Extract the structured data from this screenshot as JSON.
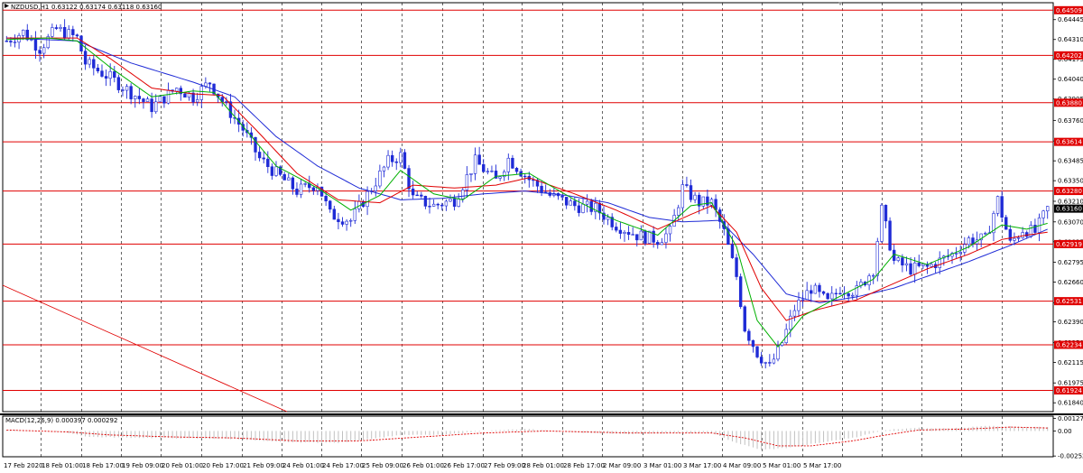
{
  "header": {
    "symbol_timeframe": "NZDUSD,H1",
    "ohlc": "0.63122 0.63174 0.63118 0.63160"
  },
  "macd_header": "MACD(12,26,9) 0.000397 0.000292",
  "colors": {
    "candles": "#1f2bd6",
    "ma_fast": "#00b000",
    "ma_mid": "#e00000",
    "ma_slow": "#1f2bd6",
    "levels": "#e00000",
    "grid": "#000000",
    "macd_hist": "#c0c0c0",
    "macd_signal": "#e00000"
  },
  "chart_data": {
    "type": "candlestick",
    "symbol": "NZDUSD",
    "timeframe": "H1",
    "ylim": [
      0.6178,
      0.6456
    ],
    "price_ticks": [
      "0.64445",
      "0.64310",
      "0.64175",
      "0.64040",
      "0.63905",
      "0.63760",
      "0.63620",
      "0.63485",
      "0.63350",
      "0.63210",
      "0.63070",
      "0.62935",
      "0.62795",
      "0.62660",
      "0.62520",
      "0.62390",
      "0.62250",
      "0.62115",
      "0.61975",
      "0.61840"
    ],
    "time_labels": [
      "17 Feb 2020",
      "18 Feb 01:00",
      "18 Feb 17:00",
      "19 Feb 09:00",
      "20 Feb 01:00",
      "20 Feb 17:00",
      "21 Feb 09:00",
      "24 Feb 01:00",
      "24 Feb 17:00",
      "25 Feb 09:00",
      "26 Feb 01:00",
      "26 Feb 17:00",
      "27 Feb 09:00",
      "28 Feb 01:00",
      "28 Feb 17:00",
      "2 Mar 09:00",
      "3 Mar 01:00",
      "3 Mar 17:00",
      "4 Mar 09:00",
      "5 Mar 01:00",
      "5 Mar 17:00"
    ],
    "current_price": "0.63160",
    "horizontal_levels": [
      "0.64509",
      "0.64202",
      "0.63880",
      "0.63614",
      "0.63280",
      "0.62919",
      "0.62531",
      "0.62234",
      "0.61924"
    ],
    "close_path": [
      [
        0,
        0.643
      ],
      [
        4,
        0.6436
      ],
      [
        8,
        0.6425
      ],
      [
        12,
        0.6438
      ],
      [
        17,
        0.6432
      ],
      [
        19,
        0.6415
      ],
      [
        25,
        0.6405
      ],
      [
        30,
        0.6395
      ],
      [
        35,
        0.6385
      ],
      [
        41,
        0.6398
      ],
      [
        45,
        0.6392
      ],
      [
        49,
        0.6402
      ],
      [
        53,
        0.6385
      ],
      [
        57,
        0.637
      ],
      [
        61,
        0.635
      ],
      [
        65,
        0.634
      ],
      [
        70,
        0.6328
      ],
      [
        75,
        0.6333
      ],
      [
        78,
        0.6312
      ],
      [
        83,
        0.6308
      ],
      [
        88,
        0.633
      ],
      [
        92,
        0.6348
      ],
      [
        95,
        0.6352
      ],
      [
        98,
        0.6323
      ],
      [
        103,
        0.6318
      ],
      [
        108,
        0.6322
      ],
      [
        113,
        0.6348
      ],
      [
        118,
        0.6335
      ],
      [
        121,
        0.635
      ],
      [
        126,
        0.6336
      ],
      [
        131,
        0.6325
      ],
      [
        137,
        0.6318
      ],
      [
        142,
        0.6316
      ],
      [
        147,
        0.6305
      ],
      [
        152,
        0.6298
      ],
      [
        157,
        0.6295
      ],
      [
        160,
        0.63
      ],
      [
        163,
        0.633
      ],
      [
        167,
        0.632
      ],
      [
        170,
        0.632
      ],
      [
        173,
        0.63
      ],
      [
        176,
        0.627
      ],
      [
        178,
        0.6235
      ],
      [
        181,
        0.6218
      ],
      [
        184,
        0.6208
      ],
      [
        187,
        0.6225
      ],
      [
        190,
        0.6248
      ],
      [
        194,
        0.6262
      ],
      [
        198,
        0.6252
      ],
      [
        201,
        0.6262
      ],
      [
        205,
        0.626
      ],
      [
        209,
        0.6275
      ],
      [
        211,
        0.6315
      ],
      [
        214,
        0.628
      ],
      [
        218,
        0.6275
      ],
      [
        222,
        0.6276
      ],
      [
        228,
        0.6285
      ],
      [
        232,
        0.6295
      ],
      [
        236,
        0.6295
      ],
      [
        239,
        0.6322
      ],
      [
        242,
        0.6292
      ],
      [
        245,
        0.6302
      ],
      [
        248,
        0.63
      ],
      [
        251,
        0.6316
      ]
    ],
    "ma_fast_path": [
      [
        0,
        0.6431
      ],
      [
        10,
        0.6432
      ],
      [
        17,
        0.643
      ],
      [
        25,
        0.6412
      ],
      [
        35,
        0.6392
      ],
      [
        45,
        0.6396
      ],
      [
        50,
        0.6395
      ],
      [
        57,
        0.6372
      ],
      [
        65,
        0.6345
      ],
      [
        75,
        0.633
      ],
      [
        83,
        0.6315
      ],
      [
        90,
        0.6325
      ],
      [
        95,
        0.6342
      ],
      [
        103,
        0.6326
      ],
      [
        110,
        0.6322
      ],
      [
        118,
        0.6338
      ],
      [
        126,
        0.634
      ],
      [
        137,
        0.6322
      ],
      [
        147,
        0.6308
      ],
      [
        157,
        0.6298
      ],
      [
        165,
        0.6318
      ],
      [
        170,
        0.632
      ],
      [
        176,
        0.629
      ],
      [
        181,
        0.624
      ],
      [
        186,
        0.6222
      ],
      [
        192,
        0.6243
      ],
      [
        200,
        0.6255
      ],
      [
        209,
        0.6268
      ],
      [
        214,
        0.6285
      ],
      [
        222,
        0.6278
      ],
      [
        232,
        0.629
      ],
      [
        240,
        0.6305
      ],
      [
        246,
        0.6302
      ],
      [
        251,
        0.6306
      ]
    ],
    "ma_mid_path": [
      [
        0,
        0.6432
      ],
      [
        17,
        0.6432
      ],
      [
        25,
        0.6418
      ],
      [
        35,
        0.6398
      ],
      [
        45,
        0.6394
      ],
      [
        52,
        0.6393
      ],
      [
        60,
        0.637
      ],
      [
        70,
        0.634
      ],
      [
        80,
        0.6322
      ],
      [
        90,
        0.632
      ],
      [
        98,
        0.6332
      ],
      [
        108,
        0.633
      ],
      [
        118,
        0.6332
      ],
      [
        126,
        0.6337
      ],
      [
        137,
        0.6326
      ],
      [
        147,
        0.6315
      ],
      [
        157,
        0.6302
      ],
      [
        165,
        0.6312
      ],
      [
        170,
        0.6318
      ],
      [
        176,
        0.63
      ],
      [
        182,
        0.6262
      ],
      [
        188,
        0.624
      ],
      [
        195,
        0.6247
      ],
      [
        205,
        0.6254
      ],
      [
        213,
        0.6264
      ],
      [
        222,
        0.6275
      ],
      [
        232,
        0.6285
      ],
      [
        240,
        0.6295
      ],
      [
        246,
        0.6298
      ],
      [
        251,
        0.63
      ]
    ],
    "ma_slow_path": [
      [
        0,
        0.6432
      ],
      [
        17,
        0.643
      ],
      [
        30,
        0.6415
      ],
      [
        45,
        0.6402
      ],
      [
        55,
        0.6392
      ],
      [
        65,
        0.6365
      ],
      [
        75,
        0.6345
      ],
      [
        85,
        0.633
      ],
      [
        95,
        0.6322
      ],
      [
        105,
        0.6323
      ],
      [
        115,
        0.6326
      ],
      [
        125,
        0.6328
      ],
      [
        135,
        0.6325
      ],
      [
        145,
        0.632
      ],
      [
        155,
        0.631
      ],
      [
        163,
        0.6307
      ],
      [
        172,
        0.6308
      ],
      [
        180,
        0.6285
      ],
      [
        188,
        0.6258
      ],
      [
        196,
        0.6252
      ],
      [
        205,
        0.6256
      ],
      [
        214,
        0.6262
      ],
      [
        222,
        0.627
      ],
      [
        232,
        0.628
      ],
      [
        242,
        0.6291
      ],
      [
        251,
        0.6302
      ]
    ],
    "macd": {
      "ylim": [
        -0.0026,
        0.0015
      ],
      "ticks": [
        "0.001274",
        "0.00",
        "-0.002526"
      ],
      "hist_path": [
        [
          0,
          0.0001
        ],
        [
          10,
          0.0
        ],
        [
          15,
          -0.0002
        ],
        [
          20,
          -0.0006
        ],
        [
          35,
          -0.0007
        ],
        [
          55,
          -0.0008
        ],
        [
          65,
          -0.0011
        ],
        [
          80,
          -0.0012
        ],
        [
          95,
          -0.0004
        ],
        [
          105,
          -0.0004
        ],
        [
          115,
          0.0
        ],
        [
          125,
          0.0002
        ],
        [
          135,
          -0.0001
        ],
        [
          150,
          -0.0003
        ],
        [
          160,
          -0.0002
        ],
        [
          170,
          -0.0002
        ],
        [
          176,
          -0.0012
        ],
        [
          182,
          -0.0019
        ],
        [
          188,
          -0.0017
        ],
        [
          196,
          -0.0012
        ],
        [
          205,
          -0.0006
        ],
        [
          212,
          0.0001
        ],
        [
          218,
          0.0003
        ],
        [
          230,
          0.0003
        ],
        [
          236,
          0.0005
        ],
        [
          246,
          0.0004
        ],
        [
          251,
          0.0004
        ]
      ],
      "signal_path": [
        [
          0,
          0.0001
        ],
        [
          15,
          -0.0001
        ],
        [
          25,
          -0.0004
        ],
        [
          40,
          -0.0006
        ],
        [
          55,
          -0.0007
        ],
        [
          70,
          -0.001
        ],
        [
          85,
          -0.001
        ],
        [
          100,
          -0.0006
        ],
        [
          115,
          -0.0002
        ],
        [
          130,
          0.0
        ],
        [
          150,
          -0.0002
        ],
        [
          170,
          -0.0002
        ],
        [
          178,
          -0.0007
        ],
        [
          186,
          -0.0015
        ],
        [
          194,
          -0.0015
        ],
        [
          204,
          -0.001
        ],
        [
          212,
          -0.0004
        ],
        [
          220,
          0.0001
        ],
        [
          232,
          0.0002
        ],
        [
          242,
          0.0004
        ],
        [
          251,
          0.0003
        ]
      ]
    }
  }
}
